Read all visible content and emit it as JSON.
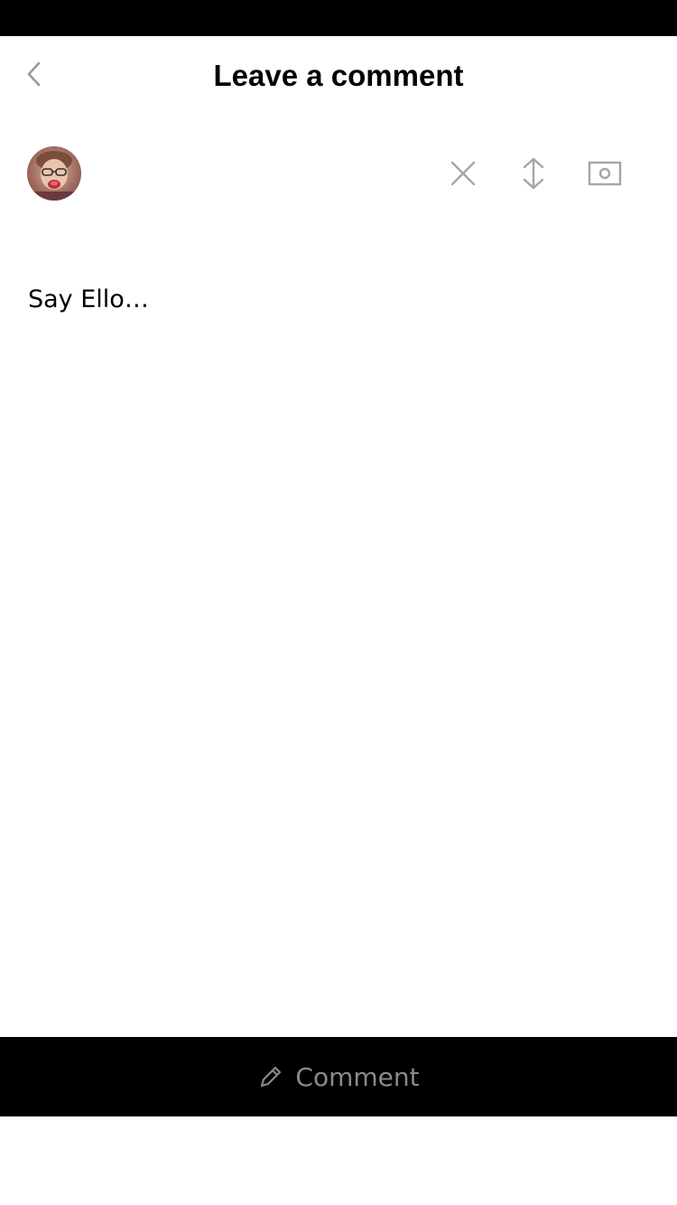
{
  "header": {
    "title": "Leave a comment",
    "back_icon": "chevron-left-icon"
  },
  "toolbar": {
    "avatar": "user-avatar",
    "icons": [
      "close-icon",
      "reorder-icon",
      "camera-icon"
    ]
  },
  "composer": {
    "placeholder": "Say Ello…",
    "value": ""
  },
  "submit": {
    "label": "Comment",
    "icon": "pencil-icon",
    "label_color": "#8a8a8a"
  },
  "colors": {
    "bars": "#000000",
    "icon_gray": "#a5a5a5"
  }
}
